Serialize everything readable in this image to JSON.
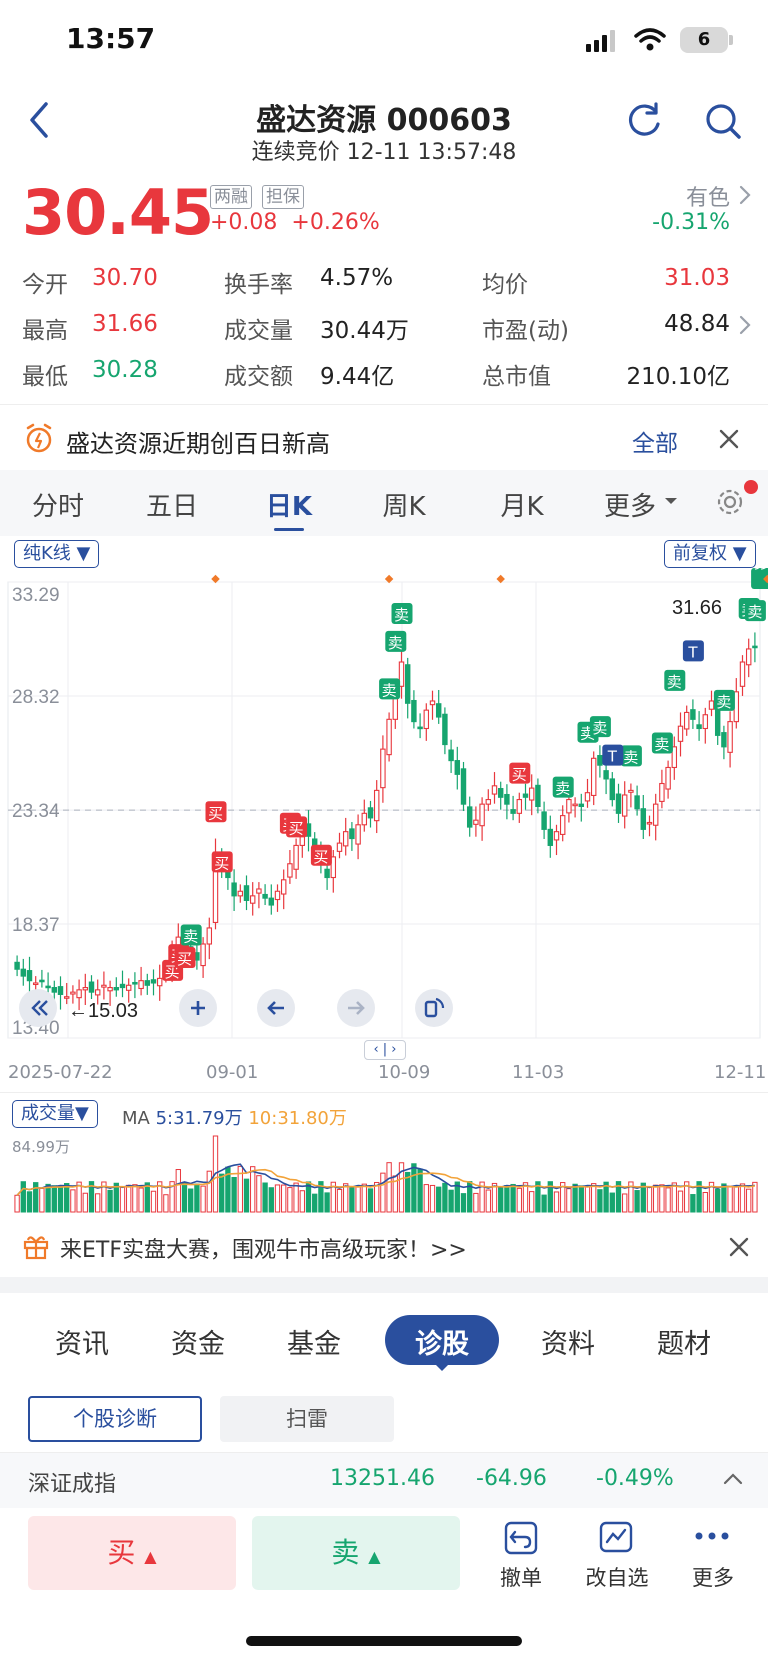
{
  "status_bar": {
    "time": "13:57",
    "battery": "6"
  },
  "header": {
    "title": "盛达资源 000603",
    "subtitle": "连续竞价 12-11 13:57:48"
  },
  "quote": {
    "price": "30.45",
    "tags": [
      "两融",
      "担保"
    ],
    "change": "+0.08",
    "change_pct": "+0.26%",
    "sector": {
      "name": "有色",
      "change_pct": "-0.31%"
    },
    "stats": {
      "open": {
        "label": "今开",
        "value": "30.70"
      },
      "high": {
        "label": "最高",
        "value": "31.66"
      },
      "low": {
        "label": "最低",
        "value": "30.28"
      },
      "turnover_rate": {
        "label": "换手率",
        "value": "4.57%"
      },
      "volume": {
        "label": "成交量",
        "value": "30.44万"
      },
      "amount": {
        "label": "成交额",
        "value": "9.44亿"
      },
      "avg_price": {
        "label": "均价",
        "value": "31.03"
      },
      "pe": {
        "label": "市盈(动)",
        "value": "48.84"
      },
      "market_cap": {
        "label": "总市值",
        "value": "210.10亿"
      }
    }
  },
  "alert": {
    "text": "盛达资源近期创百日新高",
    "action": "全部"
  },
  "chart_tabs": [
    {
      "label": "分时"
    },
    {
      "label": "五日"
    },
    {
      "label": "日K"
    },
    {
      "label": "周K"
    },
    {
      "label": "月K"
    },
    {
      "label": "更多"
    }
  ],
  "kline_controls": {
    "mode": "纯K线",
    "adjust": "前复权"
  },
  "chart_data": {
    "type": "candlestick",
    "y_ticks": [
      "33.29",
      "28.32",
      "23.34",
      "18.37",
      "13.40"
    ],
    "ylim": [
      13.4,
      33.29
    ],
    "x_labels": [
      "2025-07-22",
      "09-01",
      "10-09",
      "11-03",
      "12-11"
    ],
    "max_label": "31.66",
    "min_label": "←15.03",
    "reference_line": 23.34,
    "buy_label": "买",
    "sell_label": "卖",
    "t_label": "T",
    "closes": [
      16.4,
      16.1,
      15.9,
      15.8,
      15.9,
      15.6,
      15.4,
      15.3,
      15.2,
      15.4,
      15.5,
      15.6,
      15.4,
      15.5,
      15.7,
      15.6,
      15.5,
      15.6,
      15.7,
      15.8,
      15.9,
      15.7,
      15.8,
      16.0,
      16.5,
      17.2,
      17.8,
      17.5,
      17.0,
      16.8,
      17.5,
      18.2,
      21.5,
      20.8,
      20.4,
      19.6,
      19.8,
      19.4,
      19.6,
      19.9,
      19.5,
      19.2,
      19.8,
      20.3,
      21.0,
      21.8,
      22.5,
      22.2,
      21.4,
      21.0,
      20.4,
      21.3,
      21.9,
      22.4,
      22.1,
      22.7,
      23.2,
      23.0,
      24.2,
      26.0,
      27.3,
      28.5,
      29.8,
      28.0,
      27.2,
      26.9,
      27.7,
      28.1,
      27.4,
      26.2,
      25.5,
      24.9,
      23.6,
      22.6,
      22.9,
      23.6,
      23.8,
      24.4,
      23.9,
      23.6,
      23.2,
      23.8,
      23.9,
      24.3,
      23.5,
      22.5,
      21.8,
      22.4,
      23.1,
      23.8,
      23.6,
      23.5,
      24.1,
      25.6,
      25.3,
      24.7,
      23.8,
      23.2,
      24.0,
      24.2,
      23.4,
      22.5,
      22.8,
      23.6,
      24.5,
      25.2,
      26.1,
      27.0,
      27.6,
      27.3,
      26.9,
      27.5,
      28.1,
      26.6,
      26.1,
      27.2,
      28.5,
      29.8,
      30.37,
      30.45
    ],
    "volume_series": [
      {
        "name": "MA5",
        "label": "5:31.79万",
        "color": "#2a4f9e"
      },
      {
        "name": "MA10",
        "label": "10:31.80万",
        "color": "#f2a33a"
      }
    ],
    "volume_max_label": "84.99万"
  },
  "volume_panel": {
    "selector": "成交量",
    "ma_prefix": "MA"
  },
  "promo": {
    "text": "来ETF实盘大赛，围观牛市高级玩家！>>"
  },
  "bottom_tabs": [
    {
      "label": "资讯"
    },
    {
      "label": "资金"
    },
    {
      "label": "基金"
    },
    {
      "label": "诊股"
    },
    {
      "label": "资料"
    },
    {
      "label": "题材"
    }
  ],
  "sub_tabs": [
    {
      "label": "个股诊断"
    },
    {
      "label": "扫雷"
    }
  ],
  "index_bar": {
    "name": "深证成指",
    "value": "13251.46",
    "change": "-64.96",
    "pct": "-0.49%"
  },
  "actions": {
    "buy": "买",
    "sell": "卖",
    "cancel": "撤单",
    "watchlist": "改自选",
    "more": "更多"
  },
  "colors": {
    "up": "#e8373d",
    "down": "#16a56f",
    "accent": "#2a4f9e"
  }
}
